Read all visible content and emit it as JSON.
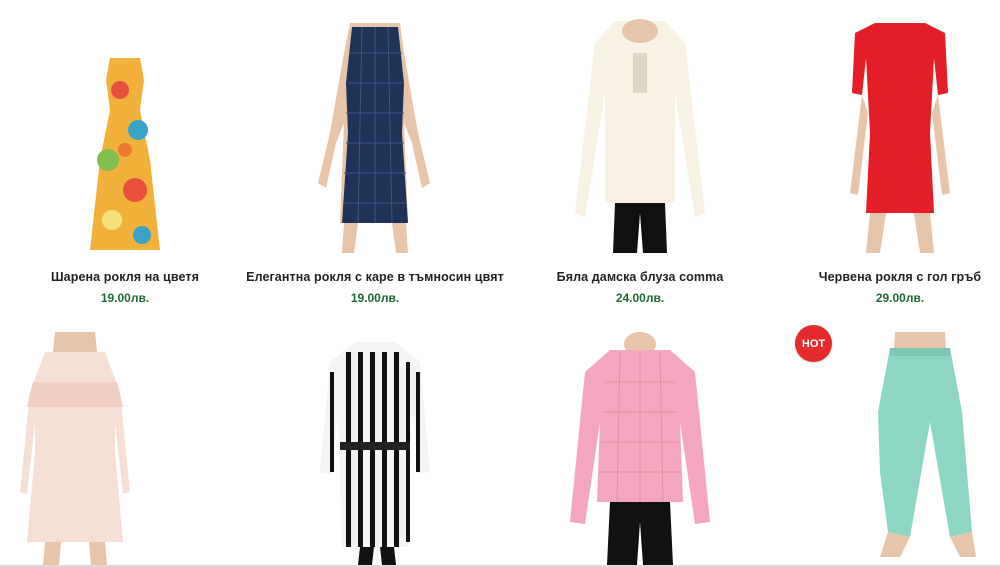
{
  "products": [
    {
      "title": "Шарена рокля на цветя",
      "price": "19.00лв.",
      "image_icon": "floral-dress-icon"
    },
    {
      "title": "Елегантна рокля с каре в тъмносин цвят",
      "price": "19.00лв.",
      "image_icon": "navy-check-dress-icon"
    },
    {
      "title": "Бяла дамска блуза comma",
      "price": "24.00лв.",
      "image_icon": "white-blouse-icon"
    },
    {
      "title": "Червена рокля с гол гръб",
      "price": "29.00лв.",
      "image_icon": "red-dress-icon"
    },
    {
      "image_icon": "pink-slip-dress-icon"
    },
    {
      "image_icon": "striped-shirt-dress-icon"
    },
    {
      "image_icon": "pink-check-blouse-icon"
    },
    {
      "image_icon": "mint-trousers-icon"
    }
  ],
  "badge": {
    "label": "HOT",
    "color": "#e32b2b"
  },
  "colors": {
    "price": "#1e6b34",
    "title": "#222222"
  }
}
